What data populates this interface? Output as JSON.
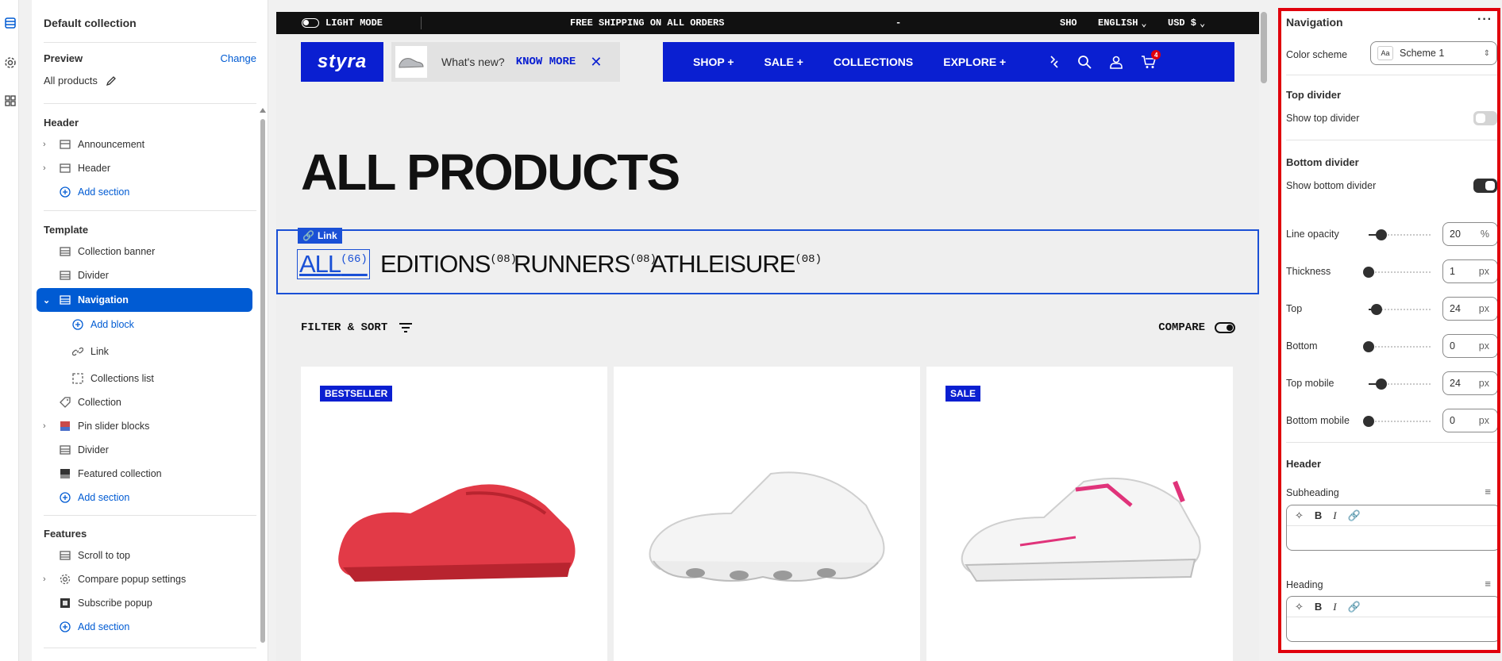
{
  "rail": {
    "icons": [
      "sections-icon",
      "settings-icon",
      "apps-icon"
    ]
  },
  "sidebar": {
    "title": "Default collection",
    "preview_label": "Preview",
    "change_label": "Change",
    "preview_value": "All products",
    "header_group": "Header",
    "header_items": [
      "Announcement",
      "Header"
    ],
    "add_section": "Add section",
    "template_group": "Template",
    "template_items": {
      "collection_banner": "Collection banner",
      "divider": "Divider",
      "navigation": "Navigation",
      "add_block": "Add block",
      "link": "Link",
      "collections_list": "Collections list",
      "collection": "Collection",
      "pin_slider": "Pin slider blocks",
      "divider2": "Divider",
      "featured": "Featured collection"
    },
    "features_group": "Features",
    "features_items": {
      "scroll_to_top": "Scroll to top",
      "compare_popup": "Compare popup settings",
      "subscribe_popup": "Subscribe popup"
    }
  },
  "store": {
    "topbar": {
      "light_mode": "LIGHT MODE",
      "shipping": "FREE SHIPPING ON ALL ORDERS",
      "dash": "-",
      "sho": "SHO",
      "language": "ENGLISH",
      "currency": "USD $"
    },
    "logo": "styra",
    "whats_new": "What's new?",
    "know_more": "KNOW MORE",
    "nav": [
      "SHOP +",
      "SALE +",
      "COLLECTIONS",
      "EXPLORE +"
    ],
    "cart_count": "4",
    "heading": "ALL PRODUCTS",
    "link_badge": "Link",
    "tabs": [
      {
        "label": "ALL",
        "count": "(66)"
      },
      {
        "label": "EDITIONS",
        "count": "(08)"
      },
      {
        "label": "RUNNERS",
        "count": "(08)"
      },
      {
        "label": "ATHLEISURE",
        "count": "(08)"
      }
    ],
    "filter_label": "FILTER & SORT",
    "compare_label": "COMPARE",
    "products": [
      {
        "badge": "BESTSELLER"
      },
      {
        "badge": ""
      },
      {
        "badge": "SALE"
      }
    ]
  },
  "panel": {
    "title": "Navigation",
    "color_scheme_label": "Color scheme",
    "color_scheme_value": "Scheme 1",
    "color_scheme_swatch": "Aa",
    "top_divider_head": "Top divider",
    "show_top_divider": "Show top divider",
    "show_top_divider_on": false,
    "bottom_divider_head": "Bottom divider",
    "show_bottom_divider": "Show bottom divider",
    "show_bottom_divider_on": true,
    "sliders": [
      {
        "label": "Line opacity",
        "value": "20",
        "unit": "%",
        "fraction": 0.2
      },
      {
        "label": "Thickness",
        "value": "1",
        "unit": "px",
        "fraction": 0.0
      },
      {
        "label": "Top",
        "value": "24",
        "unit": "px",
        "fraction": 0.12
      },
      {
        "label": "Bottom",
        "value": "0",
        "unit": "px",
        "fraction": 0.0
      },
      {
        "label": "Top mobile",
        "value": "24",
        "unit": "px",
        "fraction": 0.2
      },
      {
        "label": "Bottom mobile",
        "value": "0",
        "unit": "px",
        "fraction": 0.0
      }
    ],
    "header_head": "Header",
    "subheading_label": "Subheading",
    "heading_label": "Heading"
  },
  "colors": {
    "accent": "#005bd3",
    "brand": "#0a1fd1",
    "highlight": "#e0000c"
  }
}
